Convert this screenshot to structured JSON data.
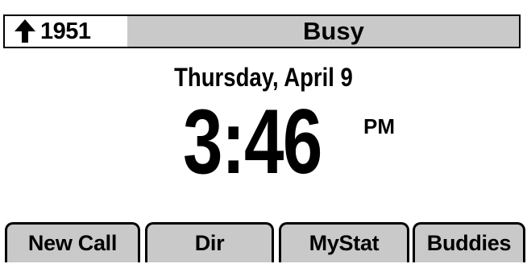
{
  "status_bar": {
    "line_icon": "phone-line-icon",
    "line_number": "1951",
    "status": "Busy"
  },
  "main": {
    "date": "Thursday, April 9",
    "time": "3:46",
    "ampm": "PM"
  },
  "softkeys": [
    {
      "label": "New Call"
    },
    {
      "label": "Dir"
    },
    {
      "label": "MyStat"
    },
    {
      "label": "Buddies"
    }
  ],
  "colors": {
    "bar_background": "#c9c9c9",
    "screen_background": "#ffffff",
    "text": "#000000"
  }
}
